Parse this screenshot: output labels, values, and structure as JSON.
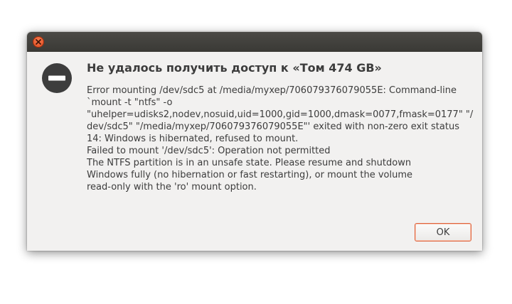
{
  "window": {
    "close_icon": "close-icon"
  },
  "dialog": {
    "icon": "error-stop-icon",
    "title": "Не удалось получить доступ к «Том 474 GB»",
    "message_lines": [
      "Error mounting /dev/sdc5 at /media/myxep/706079376079055E: Command-line",
      "`mount -t \"ntfs\" -o",
      "\"uhelper=udisks2,nodev,nosuid,uid=1000,gid=1000,dmask=0077,fmask=0177\" \"/",
      "dev/sdc5\" \"/media/myxep/706079376079055E\"' exited with non-zero exit status",
      "14: Windows is hibernated, refused to mount.",
      "Failed to mount '/dev/sdc5': Operation not permitted",
      "The NTFS partition is in an unsafe state. Please resume and shutdown",
      "Windows fully (no hibernation or fast restarting), or mount the volume",
      "read-only with the 'ro' mount option."
    ],
    "ok_label": "OK"
  },
  "colors": {
    "titlebar": "#3c3b37",
    "close_button": "#e95420",
    "dialog_background": "#f2f1f0",
    "text": "#3c3c3c",
    "focus_border": "#e0623a"
  }
}
